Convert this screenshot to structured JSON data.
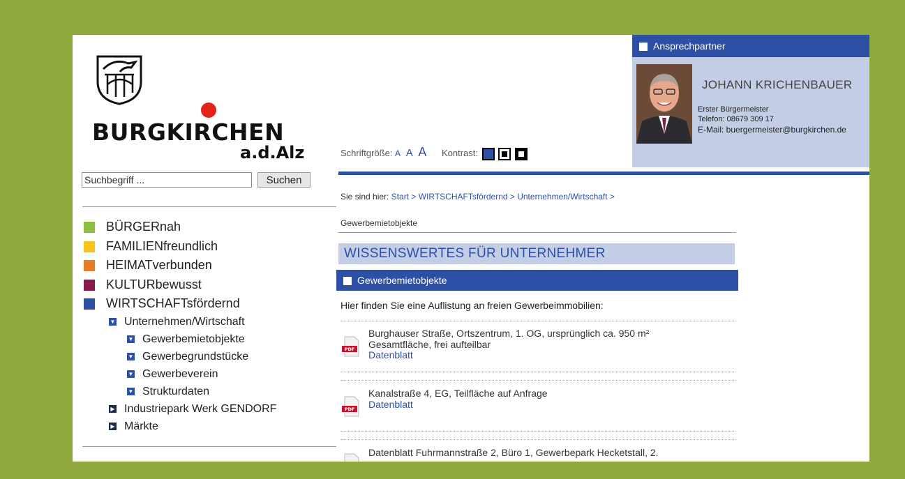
{
  "logo": {
    "name": "BURGKIRCHEN",
    "subname": "a.d.Alz"
  },
  "search": {
    "placeholder": "Suchbegriff ...",
    "button": "Suchen"
  },
  "nav": {
    "main": [
      {
        "label": "BÜRGERnah",
        "color": "#8dbf3f"
      },
      {
        "label": "FAMILIENfreundlich",
        "color": "#f5c518"
      },
      {
        "label": "HEIMATverbunden",
        "color": "#e97b24"
      },
      {
        "label": "KULTURbewusst",
        "color": "#8b1a4a"
      },
      {
        "label": "WIRTSCHAFTsfördernd",
        "color": "#2d4fa6"
      }
    ],
    "sub": [
      {
        "label": "Unternehmen/Wirtschaft",
        "icon": "chevron-down-icon"
      },
      {
        "label": "Gewerbemietobjekte",
        "icon": "chevron-down-icon"
      },
      {
        "label": "Gewerbegrundstücke",
        "icon": "chevron-down-icon"
      },
      {
        "label": "Gewerbeverein",
        "icon": "chevron-down-icon"
      },
      {
        "label": "Strukturdaten",
        "icon": "chevron-down-icon"
      },
      {
        "label": "Industriepark Werk GENDORF",
        "icon": "chevron-right-icon"
      },
      {
        "label": "Märkte",
        "icon": "chevron-right-icon"
      }
    ]
  },
  "tools": {
    "font_label": "Schriftgröße:",
    "a_small": "A",
    "a_medium": "A",
    "a_large": "A",
    "contrast_label": "Kontrast:"
  },
  "contact": {
    "header": "Ansprechpartner",
    "name": "JOHANN KRICHENBAUER",
    "role": "Erster Bürgermeister",
    "phone": "Telefon: 08679 309 17",
    "email": "E-Mail: buergermeister@burgkirchen.de"
  },
  "breadcrumb": {
    "label": "Sie sind hier:",
    "trail": "Start > WIRTSCHAFTsfördernd > Unternehmen/Wirtschaft >",
    "current": "Gewerbemietobjekte"
  },
  "main": {
    "section_title": "WISSENSWERTES FÜR UNTERNEHMER",
    "box_title": "Gewerbemietobjekte",
    "intro": "Hier finden Sie eine Auflistung an freien Gewerbeimmobilien:",
    "items": [
      {
        "line1": "Burghauser Straße, Ortszentrum, 1. OG, ursprünglich ca. 950 m²",
        "line2": "Gesamtfläche, frei aufteilbar",
        "link": "Datenblatt"
      },
      {
        "line1": "Kanalstraße 4, EG, Teilfläche auf Anfrage",
        "line2": "",
        "link": "Datenblatt"
      },
      {
        "line1": "Datenblatt Fuhrmannstraße 2, Büro 1, Gewerbepark Hecketstall, 2.",
        "line2": "",
        "link": ""
      }
    ]
  },
  "colors": {
    "frame": "#8fa93d",
    "accent_blue": "#2d4fa6",
    "light_blue": "#c3cde6",
    "logo_red": "#e2231a"
  }
}
